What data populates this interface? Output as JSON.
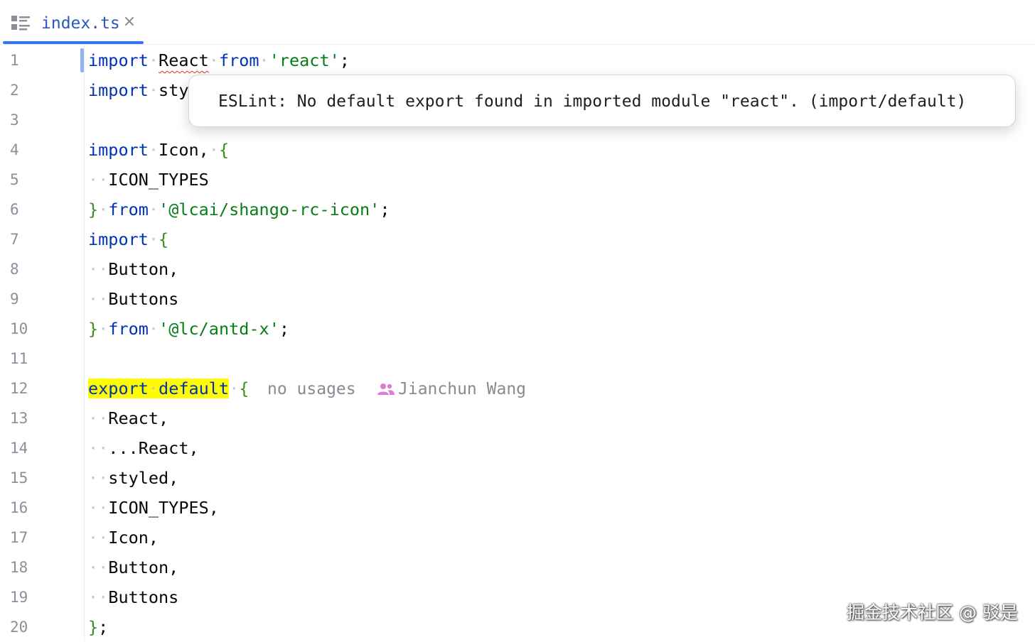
{
  "tab": {
    "filename": "index.ts",
    "close_glyph": "×",
    "icon": "structure-icon"
  },
  "accent_color": "#3574f0",
  "gutter": {
    "line_numbers": [
      "1",
      "2",
      "3",
      "4",
      "5",
      "6",
      "7",
      "8",
      "9",
      "10",
      "11",
      "12",
      "13",
      "14",
      "15",
      "16",
      "17",
      "18",
      "19",
      "20"
    ]
  },
  "code": {
    "l1": {
      "kw": "import",
      "dot": "·",
      "ident": "React",
      "kw2": "from",
      "str": "'react'",
      "end": ";"
    },
    "l2": {
      "kw": "import",
      "dot": "·",
      "ident": "sty"
    },
    "l4": {
      "kw": "import",
      "dot": "·",
      "ident": "Icon,",
      "brace": "{"
    },
    "l5": {
      "indent": "··",
      "ident": "ICON_TYPES"
    },
    "l6": {
      "brace": "}",
      "kw": "from",
      "str": "'@lcai/shango-rc-icon'",
      "end": ";"
    },
    "l7": {
      "kw": "import",
      "dot": "·",
      "brace": "{"
    },
    "l8": {
      "indent": "··",
      "ident": "Button,"
    },
    "l9": {
      "indent": "··",
      "ident": "Buttons"
    },
    "l10": {
      "brace": "}",
      "kw": "from",
      "str": "'@lc/antd-x'",
      "end": ";"
    },
    "l12": {
      "kw1": "export",
      "dot": "·",
      "kw2": "default",
      "brace": "{"
    },
    "l13": {
      "indent": "··",
      "ident": "React,"
    },
    "l14": {
      "indent": "··",
      "ident": "...React,"
    },
    "l15": {
      "indent": "··",
      "ident": "styled,"
    },
    "l16": {
      "indent": "··",
      "ident": "ICON_TYPES,"
    },
    "l17": {
      "indent": "··",
      "ident": "Icon,"
    },
    "l18": {
      "indent": "··",
      "ident": "Button,"
    },
    "l19": {
      "indent": "··",
      "ident": "Buttons"
    },
    "l20": {
      "brace": "}",
      "end": ";"
    }
  },
  "inlay_hints": {
    "usages": "no usages",
    "author": "Jianchun Wang",
    "author_icon": "people-icon"
  },
  "tooltip": {
    "message": "ESLint: No default export found in imported module \"react\". (import/default)"
  },
  "watermark": {
    "text": "掘金技术社区 @ 驳是"
  }
}
